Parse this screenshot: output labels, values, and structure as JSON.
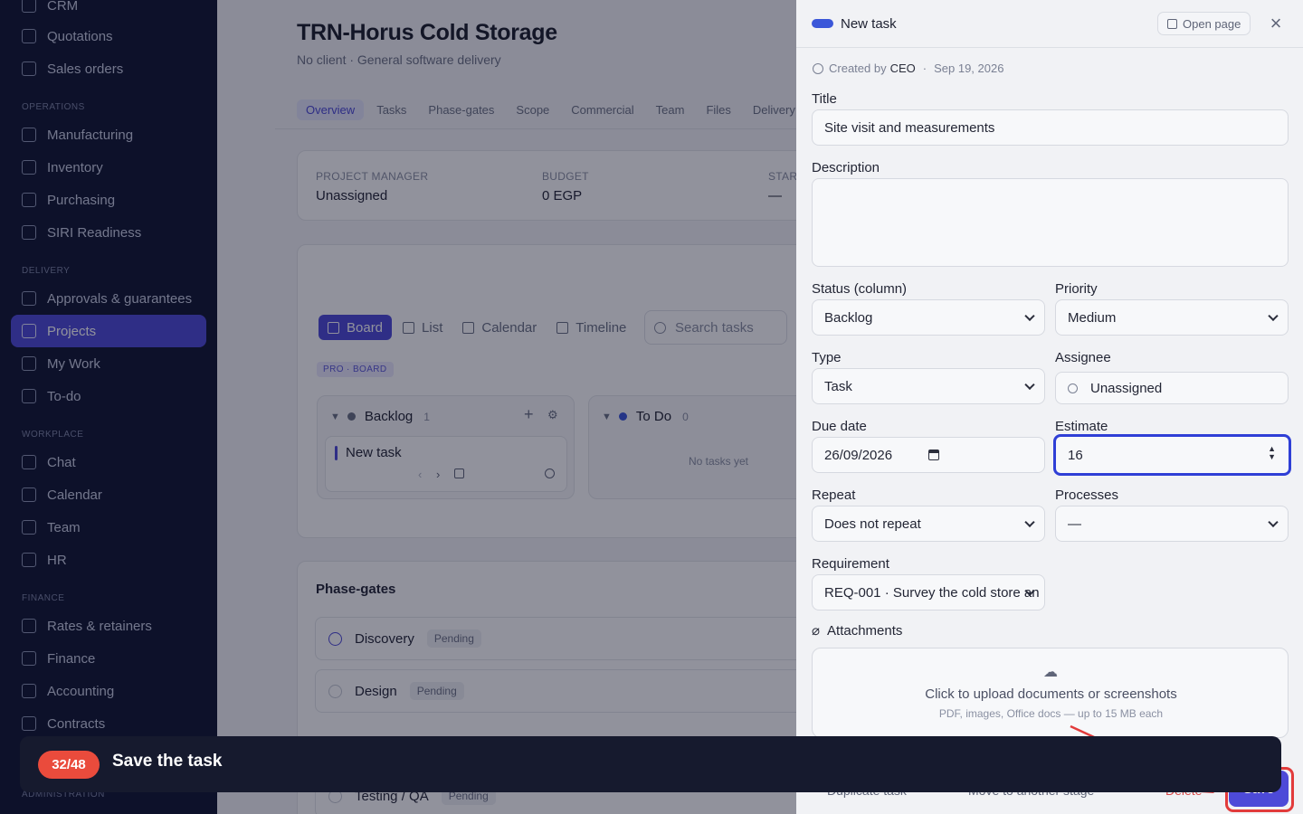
{
  "sidebar": {
    "items": [
      {
        "label": "CRM"
      },
      {
        "label": "Quotations"
      },
      {
        "label": "Sales orders"
      },
      {
        "label": "Manufacturing"
      },
      {
        "label": "Inventory"
      },
      {
        "label": "Purchasing"
      },
      {
        "label": "SIRI Readiness"
      },
      {
        "label": "Approvals & guarantees"
      },
      {
        "label": "Projects"
      },
      {
        "label": "My Work"
      },
      {
        "label": "To-do"
      },
      {
        "label": "Chat"
      },
      {
        "label": "Calendar"
      },
      {
        "label": "Team"
      },
      {
        "label": "HR"
      },
      {
        "label": "Rates & retainers"
      },
      {
        "label": "Finance"
      },
      {
        "label": "Accounting"
      },
      {
        "label": "Contracts"
      }
    ],
    "sections": {
      "operations": "OPERATIONS",
      "delivery": "DELIVERY",
      "workplace": "WORKPLACE",
      "finance": "FINANCE",
      "administration": "ADMINISTRATION"
    },
    "active_item": "Projects"
  },
  "project": {
    "title": "TRN-Horus Cold Storage",
    "subtitle": "No client · General software delivery",
    "tabs": [
      "Overview",
      "Tasks",
      "Phase-gates",
      "Scope",
      "Commercial",
      "Team",
      "Files",
      "Delivery"
    ],
    "meta": {
      "pm_label": "PROJECT MANAGER",
      "pm_value": "Unassigned",
      "budget_label": "BUDGET",
      "budget_value": "0 EGP",
      "start_label": "START",
      "start_value": "—"
    },
    "views": [
      "Board",
      "List",
      "Calendar",
      "Timeline"
    ],
    "search_placeholder": "Search tasks",
    "pro_badge": "PRO · BOARD",
    "columns": [
      {
        "name": "Backlog",
        "count": "1",
        "color": "#6b7184"
      },
      {
        "name": "To Do",
        "count": "0",
        "color": "#3b57d9"
      }
    ],
    "backlog_task": "New task",
    "todo_empty": "No tasks yet",
    "phase_gates": {
      "title": "Phase-gates",
      "rows": [
        {
          "name": "Discovery",
          "status": "Pending"
        },
        {
          "name": "Design",
          "status": "Pending"
        },
        {
          "name": "Testing / QA",
          "status": "Pending"
        }
      ]
    }
  },
  "drawer": {
    "title": "New task",
    "open_page": "Open page",
    "close": "×",
    "created_by_label": "Created by",
    "created_by": "CEO",
    "created_date": "Sep 19, 2026",
    "fields": {
      "title_label": "Title",
      "title_value": "Site visit and measurements",
      "description_label": "Description",
      "status_label": "Status (column)",
      "status_value": "Backlog",
      "priority_label": "Priority",
      "priority_value": "Medium",
      "type_label": "Type",
      "type_value": "Task",
      "assignee_label": "Assignee",
      "assignee_value": "Unassigned",
      "due_label": "Due date",
      "due_value": "26/09/2026",
      "estimate_label": "Estimate",
      "estimate_value": "16",
      "repeat_label": "Repeat",
      "repeat_value": "Does not repeat",
      "processes_label": "Processes",
      "processes_value": "—",
      "requirement_label": "Requirement",
      "requirement_value": "REQ-001 · Survey the cold store an"
    },
    "attachments": {
      "label": "Attachments",
      "upload_text": "Click to upload documents or screenshots",
      "upload_sub": "PDF, images, Office docs — up to 15 MB each"
    },
    "footer": {
      "duplicate": "Duplicate task",
      "move": "Move to another stage",
      "delete": "Delete",
      "save": "Save"
    }
  },
  "tutorial": {
    "step": "32/48",
    "text": "Save the task"
  }
}
